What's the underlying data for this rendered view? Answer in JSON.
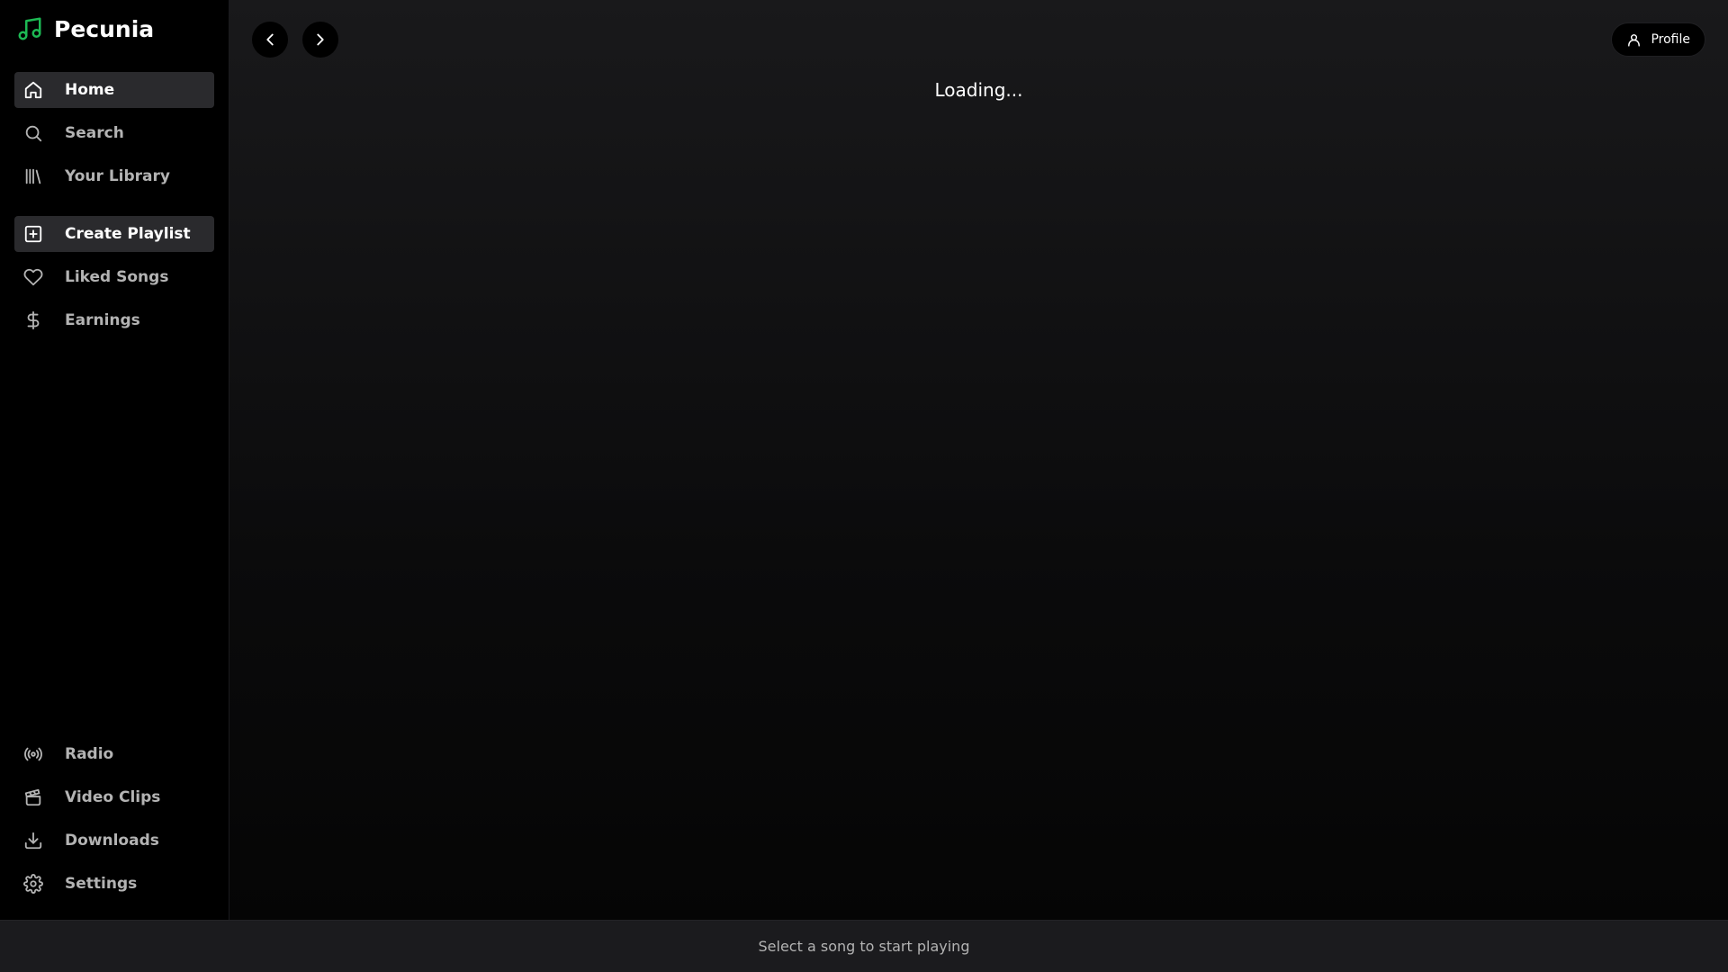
{
  "app": {
    "name": "Pecunia",
    "accent": "#1db954"
  },
  "sidebar": {
    "primary": [
      {
        "label": "Home",
        "icon": "home-icon",
        "active": true
      },
      {
        "label": "Search",
        "icon": "search-icon",
        "active": false
      },
      {
        "label": "Your Library",
        "icon": "library-icon",
        "active": false
      }
    ],
    "secondary": [
      {
        "label": "Create Playlist",
        "icon": "plus-square-icon",
        "active": true
      },
      {
        "label": "Liked Songs",
        "icon": "heart-icon",
        "active": false
      },
      {
        "label": "Earnings",
        "icon": "dollar-icon",
        "active": false
      }
    ],
    "bottom": [
      {
        "label": "Radio",
        "icon": "radio-icon"
      },
      {
        "label": "Video Clips",
        "icon": "clapperboard-icon"
      },
      {
        "label": "Downloads",
        "icon": "download-icon"
      },
      {
        "label": "Settings",
        "icon": "gear-icon"
      }
    ]
  },
  "topbar": {
    "profile_label": "Profile"
  },
  "main": {
    "loading_text": "Loading..."
  },
  "player": {
    "status_text": "Select a song to start playing"
  }
}
